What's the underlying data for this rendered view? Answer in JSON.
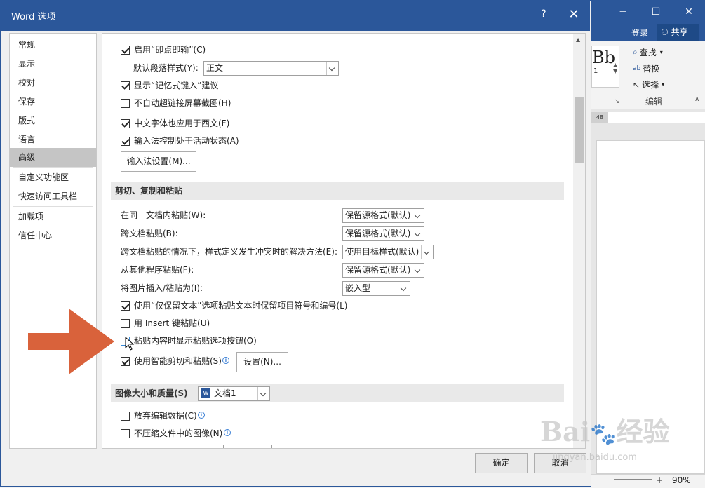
{
  "background_window": {
    "login": "登录",
    "share": "共享",
    "find": "查找",
    "replace": "替换",
    "select": "选择",
    "editing_group": "编辑",
    "style_preview": "Bb",
    "style_sub": "1",
    "ruler_num": "48",
    "zoom": "90%"
  },
  "dialog": {
    "title": "Word 选项",
    "help": "?",
    "close": "✕",
    "ok": "确定",
    "cancel": "取消"
  },
  "sidebar": {
    "items": [
      {
        "label": "常规"
      },
      {
        "label": "显示"
      },
      {
        "label": "校对"
      },
      {
        "label": "保存"
      },
      {
        "label": "版式"
      },
      {
        "label": "语言"
      },
      {
        "label": "高级",
        "active": true
      },
      {
        "label": "自定义功能区"
      },
      {
        "label": "快速访问工具栏"
      },
      {
        "label": "加载项"
      },
      {
        "label": "信任中心"
      }
    ]
  },
  "editing": {
    "click_and_type": {
      "label": "启用“即点即输”(C)",
      "checked": true
    },
    "default_para_style_label": "默认段落样式(Y):",
    "default_para_style_value": "正文",
    "autocomplete": {
      "label": "显示“记忆式键入”建议",
      "checked": true
    },
    "no_hyperlink_screenshot": {
      "label": "不自动超链接屏幕截图(H)",
      "checked": false
    },
    "chinese_font_western": {
      "label": "中文字体也应用于西文(F)",
      "checked": true
    },
    "ime_control": {
      "label": "输入法控制处于活动状态(A)",
      "checked": true
    },
    "ime_settings_button": "输入法设置(M)..."
  },
  "cut_copy_paste": {
    "heading": "剪切、复制和粘贴",
    "rows": [
      {
        "label": "在同一文档内粘贴(W):",
        "value": "保留源格式(默认)"
      },
      {
        "label": "跨文档粘贴(B):",
        "value": "保留源格式(默认)"
      },
      {
        "label": "跨文档粘贴的情况下，样式定义发生冲突时的解决方法(E):",
        "value": "使用目标样式(默认)"
      },
      {
        "label": "从其他程序粘贴(F):",
        "value": "保留源格式(默认)"
      },
      {
        "label": "将图片插入/粘贴为(I):",
        "value": "嵌入型"
      }
    ],
    "keep_bullets": {
      "label": "使用“仅保留文本”选项粘贴文本时保留项目符号和编号(L)",
      "checked": true
    },
    "insert_key": {
      "label": "用 Insert 键粘贴(U)",
      "checked": false
    },
    "show_paste_options": {
      "label": "粘贴内容时显示粘贴选项按钮(O)",
      "checked": false
    },
    "smart_cut": {
      "label": "使用智能剪切和粘贴(S)",
      "checked": true
    },
    "settings_button": "设置(N)..."
  },
  "image_quality": {
    "heading": "图像大小和质量(S)",
    "document": "文档1",
    "discard_edit": {
      "label": "放弃编辑数据(C)",
      "checked": false
    },
    "no_compress": {
      "label": "不压缩文件中的图像(N)",
      "checked": false
    }
  },
  "colors": {
    "titlebar": "#2b579a",
    "arrow": "#d9623b",
    "selected_item": "#c5c5c5"
  }
}
